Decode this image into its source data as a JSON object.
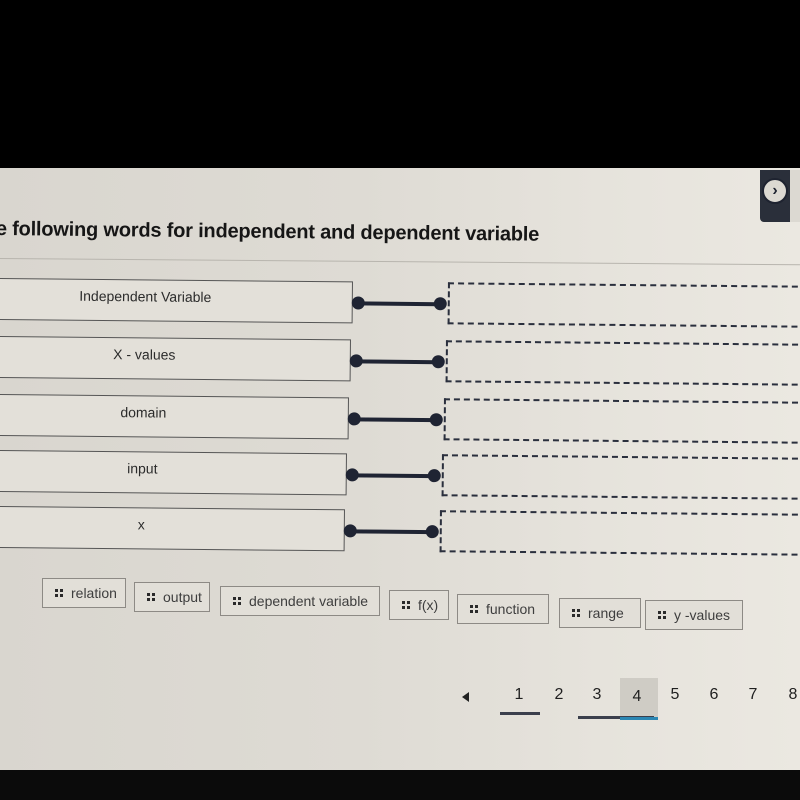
{
  "instruction": "e following words for independent  and dependent variable",
  "next_button": {
    "icon": "chevron-right-circle-icon",
    "glyph": "›"
  },
  "terms": [
    {
      "label": "Independent Variable"
    },
    {
      "label": "X - values"
    },
    {
      "label": "domain"
    },
    {
      "label": "input"
    },
    {
      "label": "x"
    }
  ],
  "drop_zones": [
    {
      "value": ""
    },
    {
      "value": ""
    },
    {
      "value": ""
    },
    {
      "value": ""
    },
    {
      "value": ""
    }
  ],
  "answer_chips": [
    {
      "label": "relation"
    },
    {
      "label": "output"
    },
    {
      "label": "dependent variable"
    },
    {
      "label": "f(x)"
    },
    {
      "label": "function"
    },
    {
      "label": "range"
    },
    {
      "label": "y -values"
    }
  ],
  "pagination": {
    "prev_icon": "triangle-left-icon",
    "pages": [
      "1",
      "2",
      "3",
      "4",
      "5",
      "6",
      "7",
      "8"
    ],
    "current": "4"
  },
  "colors": {
    "accent": "#2b86b3",
    "connector": "#1f2433"
  }
}
